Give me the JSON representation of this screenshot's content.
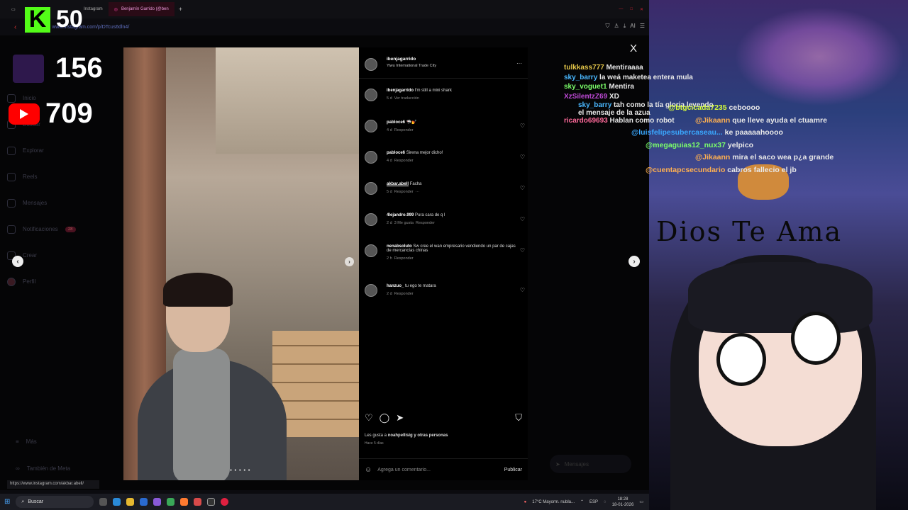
{
  "browser": {
    "tabs": [
      {
        "label": "Instagram"
      },
      {
        "label": "Benjamín Garrido (@ben"
      }
    ],
    "new_tab": "+",
    "url": "www.instagram.com/p/DTcus6dln4/",
    "status_url": "https://www.instagram.com/akbar.abell/"
  },
  "overlay": {
    "kick_letter": "K",
    "kick_count": "50",
    "twitch_count": "156",
    "youtube_count": "709"
  },
  "sidenav": {
    "items": [
      {
        "label": "Inicio",
        "icon": "home-icon"
      },
      {
        "label": "Buscar",
        "icon": "search-icon"
      },
      {
        "label": "Explorar",
        "icon": "compass-icon"
      },
      {
        "label": "Reels",
        "icon": "reels-icon"
      },
      {
        "label": "Mensajes",
        "icon": "send-icon"
      },
      {
        "label": "Notificaciones",
        "icon": "heart-icon",
        "badge": "28"
      },
      {
        "label": "Crear",
        "icon": "plus-icon"
      },
      {
        "label": "Perfil",
        "icon": "avatar-icon"
      }
    ],
    "more": "Más",
    "meta": "También de Meta"
  },
  "post": {
    "author": "ibenjagarrido",
    "location": "Yiwu International Trade City",
    "caption_user": "ibenjagarrido",
    "caption": "I'm still a mini shark",
    "caption_meta": "5 d",
    "translate": "Ver traducción",
    "comments": [
      {
        "user": "pabloce6",
        "text": "🦈💅",
        "meta": "4 d",
        "reply": "Responder"
      },
      {
        "user": "pabloce6",
        "text": "Sirena mejor dicho!",
        "meta": "4 d",
        "reply": "Responder"
      },
      {
        "user": "akbar.abell",
        "text": "Facha",
        "meta": "5 d",
        "reply": "Responder"
      },
      {
        "user": "4lejandro.999",
        "text": "Pura cara de q l",
        "meta": "2 d",
        "likes": "3 Me gusta",
        "reply": "Responder"
      },
      {
        "user": "nenabsoluto",
        "text": "Sw cree el wan empresario vendiendo un par de cajas de mercancías chinas",
        "meta": "2 h",
        "reply": "Responder"
      },
      {
        "user": "hanzuo_",
        "text": "tu ego te matara",
        "meta": "2 d",
        "reply": "Responder"
      }
    ],
    "likes_prefix": "Les gusta a",
    "likes_user": "noahpellisig",
    "likes_suffix": "y otras personas",
    "posted_ago": "Hace 5 días",
    "add_comment": "Agrega un comentario...",
    "publish": "Publicar",
    "more_icon": "···",
    "close": "X"
  },
  "messages_pill": "Mensajes",
  "chat_top": [
    {
      "user": "tulkkass777",
      "text": "Mentiraaaa",
      "color": "#e6c84a"
    },
    {
      "user": "sky_barry",
      "text": "la weá maketea entera mula",
      "color": "#4ab8ff"
    },
    {
      "user": "sky_voguet1",
      "text": "Mentira",
      "color": "#7cff6a"
    },
    {
      "user": "XzSilentzZ69",
      "text": "XD",
      "color": "#c04ad8"
    },
    {
      "user": "sky_barry",
      "text": "tah como la tía gloria leyendo el mensaje de la azua",
      "color": "#4ab8ff"
    },
    {
      "user": "ricardo69693",
      "text": "Hablan como robot",
      "color": "#ff6a9a"
    }
  ],
  "chat_bottom": [
    {
      "user": "@btgcicada7235",
      "text": "ceboooo",
      "color": "#d8ff3a"
    },
    {
      "user": "@Jikaann",
      "text": "que lleve ayuda el ctuamre",
      "color": "#ffb050"
    },
    {
      "user": "@luisfelipesubercaseau...",
      "text": "ke paaaaahoooo",
      "color": "#3aa8ff"
    },
    {
      "user": "@megaguias12_nux37",
      "text": "yelpico",
      "color": "#7cff6a"
    },
    {
      "user": "@Jikaann",
      "text": "mira el saco wea p¿a grande",
      "color": "#ffb050"
    },
    {
      "user": "@cuentapcsecundario",
      "text": "cabros fallecio el jb",
      "color": "#ffb050"
    }
  ],
  "stream_text": "Dios Te Ama",
  "taskbar": {
    "search": "Buscar",
    "weather": "17°C  Mayorm. nubla...",
    "lang": "ESP",
    "time": "18:28",
    "date": "18-01-2026"
  }
}
